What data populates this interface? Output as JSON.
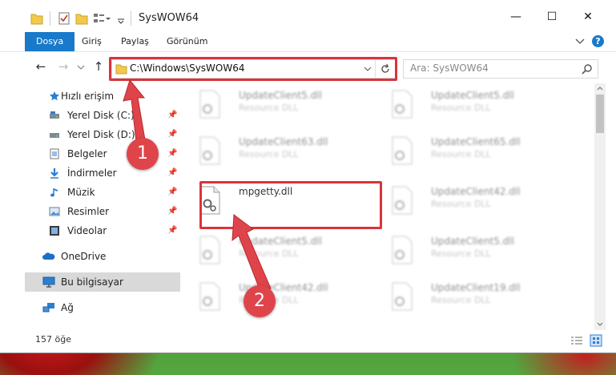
{
  "window": {
    "title": "SysWOW64",
    "controls": {
      "minimize": "—",
      "maximize": "☐",
      "close": "✕"
    }
  },
  "ribbon": {
    "tabs": [
      "Dosya",
      "Giriş",
      "Paylaş",
      "Görünüm"
    ],
    "help": "?"
  },
  "nav": {
    "address": "C:\\Windows\\SysWOW64",
    "search_placeholder": "Ara: SysWOW64"
  },
  "sidebar": {
    "items": [
      {
        "label": "Hızlı erişim",
        "icon": "star-icon"
      },
      {
        "label": "Yerel Disk (C:)",
        "icon": "drive-icon",
        "pinned": true
      },
      {
        "label": "Yerel Disk (D:)",
        "icon": "drive-icon",
        "pinned": true
      },
      {
        "label": "Belgeler",
        "icon": "document-icon",
        "pinned": true
      },
      {
        "label": "İndirmeler",
        "icon": "download-icon",
        "pinned": true
      },
      {
        "label": "Müzik",
        "icon": "music-icon",
        "pinned": true
      },
      {
        "label": "Resimler",
        "icon": "pictures-icon",
        "pinned": true
      },
      {
        "label": "Videolar",
        "icon": "video-icon",
        "pinned": true
      },
      {
        "label": "OneDrive",
        "icon": "cloud-icon"
      },
      {
        "label": "Bu bilgisayar",
        "icon": "computer-icon",
        "selected": true
      },
      {
        "label": "Ağ",
        "icon": "network-icon"
      }
    ]
  },
  "files": [
    {
      "name": "UpdateClient5.dll",
      "desc": "Resource DLL"
    },
    {
      "name": "UpdateClient5.dll",
      "desc": "Resource DLL"
    },
    {
      "name": "UpdateClient63.dll",
      "desc": "Resource DLL"
    },
    {
      "name": "UpdateClient65.dll",
      "desc": "Resource DLL"
    },
    {
      "name": "mpgetty.dll",
      "desc": ""
    },
    {
      "name": "UpdateClient42.dll",
      "desc": "Resource DLL"
    },
    {
      "name": "UpdateClient5.dll",
      "desc": "Resource DLL"
    },
    {
      "name": "UpdateClient5.dll",
      "desc": "Resource DLL"
    },
    {
      "name": "UpdateClient42.dll",
      "desc": "Resource DLL"
    },
    {
      "name": "UpdateClient19.dll",
      "desc": "Resource DLL"
    }
  ],
  "annotations": {
    "step1": "1",
    "step2": "2"
  },
  "status": {
    "count": "157 öğe"
  },
  "colors": {
    "accent": "#1979ca",
    "highlight": "#d9343a",
    "selected": "#d9d9d9"
  }
}
